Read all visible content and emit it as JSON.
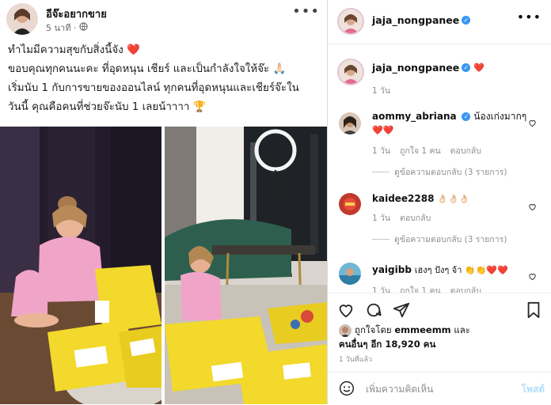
{
  "facebook": {
    "page_name": "อีจ๊ะอยากขาย",
    "time": "5 นาที ·",
    "more": "•••",
    "lines": [
      "ทำไมมีความสุขกับสิ่งนี้จัง ❤️",
      "ขอบคุณทุกคนนะคะ ที่อุดหนุน เชียร์ และเป็นกำลังใจให้จ๊ะ 🙏🏻",
      "เริ่มนับ 1 กับการขายของออนไลน์ ทุกคนที่อุดหนุนและเชียร์จ๊ะใน",
      "วันนี้ คุณคือคนที่ช่วยจ๊ะนับ 1 เลยน้าาาา 🏆"
    ]
  },
  "instagram": {
    "header_user": "jaja_nongpanee",
    "caption_user": "jaja_nongpanee",
    "caption_heart": "❤️",
    "caption_time": "1 วัน",
    "comments": [
      {
        "user": "aommy_abriana",
        "text": "น้องเก่งมากๆ",
        "second_line": "❤️❤️",
        "time": "1 วัน",
        "likes": "ถูกใจ 1 คน",
        "reply": "ตอบกลับ",
        "view_replies": "ดูข้อความตอบกลับ (3 รายการ)"
      },
      {
        "user": "kaidee2288",
        "text": "👌🏻👌🏻👌🏻",
        "time": "1 วัน",
        "reply": "ตอบกลับ",
        "view_replies": "ดูข้อความตอบกลับ (3 รายการ)"
      },
      {
        "user": "yaigibb",
        "text": "เฮงๆ ปังๆ จ้า 👏👏❤️❤️",
        "time": "1 วัน",
        "likes": "ถูกใจ 1 คน",
        "reply": "ตอบกลับ"
      }
    ],
    "liked_prefix": "ถูกใจโดย",
    "liked_user": "emmeemm",
    "liked_and": "และ",
    "liked_others": "คนอื่นๆ อีก 18,920 คน",
    "ago": "1 วันที่แล้ว",
    "add_comment_placeholder": "เพิ่มความคิดเห็น",
    "post_label": "โพสต์"
  },
  "colors": {
    "verified": "#3897f0",
    "heart": "#e0245e",
    "post_button": "#b2dffc",
    "bag_yellow": "#f2d92b"
  }
}
